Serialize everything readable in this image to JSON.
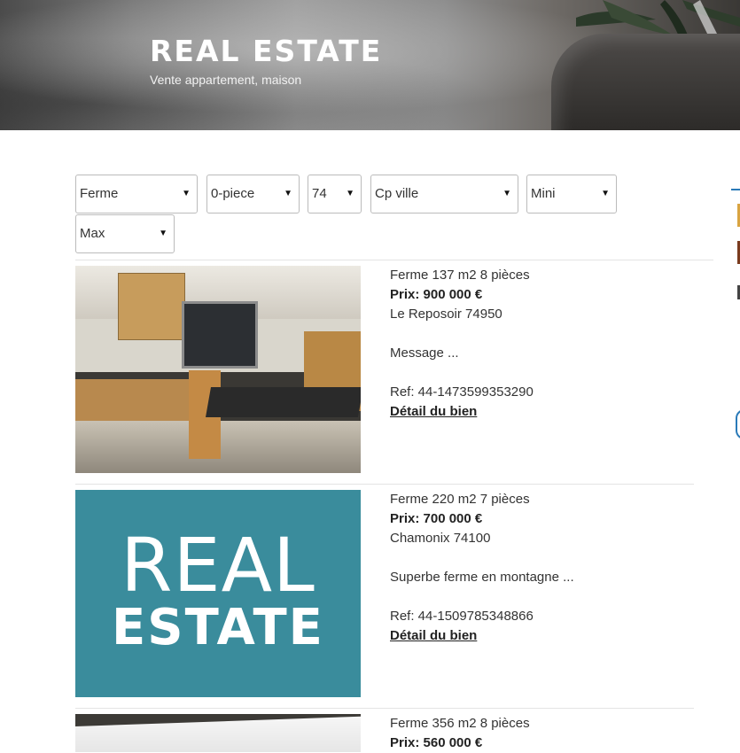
{
  "header": {
    "title": "REAL ESTATE",
    "subtitle": "Vente appartement, maison"
  },
  "filters": {
    "type": "Ferme",
    "pieces": "0-piece",
    "department": "74",
    "city": "Cp ville",
    "min": "Mini",
    "max": "Max"
  },
  "listings": [
    {
      "summary": "Ferme 137 m2 8 pièces",
      "price": "Prix: 900 000 €",
      "location": "Le Reposoir 74950",
      "message": "Message ...",
      "ref": "Ref: 44-1473599353290",
      "detail": "Détail du bien"
    },
    {
      "summary": "Ferme 220 m2 7 pièces",
      "price": "Prix: 700 000 €",
      "location": "Chamonix 74100",
      "message": "Superbe ferme en montagne ...",
      "ref": "Ref: 44-1509785348866",
      "detail": "Détail du bien",
      "image_text_1": "REAL",
      "image_text_2": "ESTATE"
    },
    {
      "summary": "Ferme 356 m2 8 pièces",
      "price": "Prix: 560 000 €"
    }
  ],
  "colors": {
    "accent_blue": "#2a7ab8",
    "banner_teal": "#3a8c9c",
    "sidebar_orange": "#d9a441"
  }
}
